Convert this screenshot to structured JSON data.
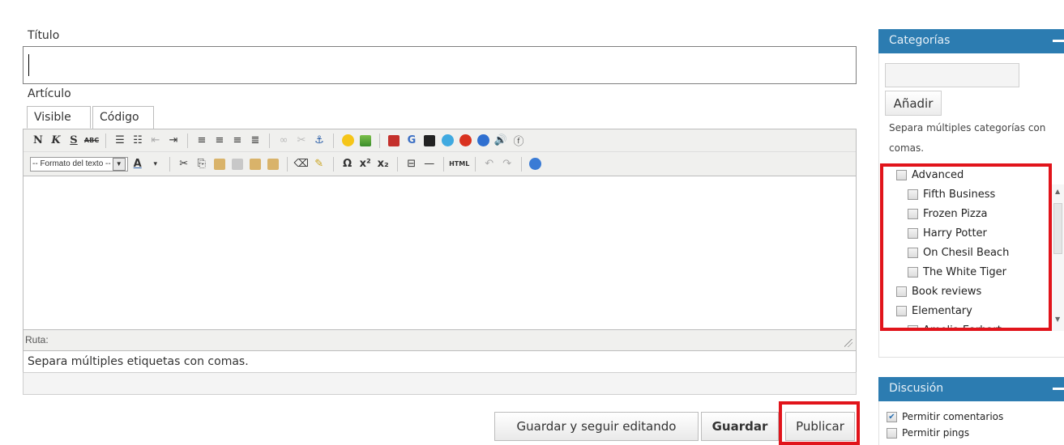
{
  "editor": {
    "title_label": "Título",
    "title_value": "",
    "article_label": "Artículo",
    "tabs": [
      {
        "label": "Visible",
        "active": true
      },
      {
        "label": "Código",
        "active": false
      }
    ],
    "toolbar_row1": {
      "bold": "N",
      "italic": "K",
      "underline": "S",
      "strike": "ABC",
      "icons": [
        "bold-icon",
        "italic-icon",
        "underline-icon",
        "strikethrough-icon",
        "bullet-list-icon",
        "numbered-list-icon",
        "outdent-icon",
        "indent-icon",
        "align-left-icon",
        "align-center-icon",
        "align-right-icon",
        "justify-icon",
        "link-icon",
        "unlink-icon",
        "anchor-icon",
        "emoticon-icon",
        "image-icon",
        "youtube-icon",
        "google-icon",
        "info-icon",
        "quicktime-icon",
        "realmedia-icon",
        "windows-media-icon",
        "audio-icon",
        "flash-icon"
      ]
    },
    "toolbar_row2": {
      "format_placeholder": "-- Formato del texto --",
      "html_label": "HTML",
      "omega": "Ω",
      "icons": [
        "text-color-icon",
        "cut-icon",
        "copy-icon",
        "paste-icon",
        "paste-text-icon",
        "paste-word-icon",
        "paste-special-icon",
        "eraser-icon",
        "clean-icon",
        "special-char-icon",
        "superscript-icon",
        "subscript-icon",
        "page-break-icon",
        "horizontal-rule-icon",
        "html-icon",
        "undo-icon",
        "redo-icon",
        "help-icon"
      ]
    },
    "path_label": "Ruta:",
    "tags_hint": "Separa múltiples etiquetas con comas.",
    "tags_value": "",
    "buttons": {
      "save_continue": "Guardar y seguir editando",
      "save": "Guardar",
      "publish": "Publicar"
    }
  },
  "sidebar": {
    "categories": {
      "title": "Categorías",
      "new_category_value": "",
      "add_label": "Añadir",
      "hint": "Separa múltiples categorías con comas.",
      "items": [
        {
          "label": "Advanced",
          "level": 0,
          "checked": false
        },
        {
          "label": "Fifth Business",
          "level": 1,
          "checked": false
        },
        {
          "label": "Frozen Pizza",
          "level": 1,
          "checked": false
        },
        {
          "label": "Harry Potter",
          "level": 1,
          "checked": false
        },
        {
          "label": "On Chesil Beach",
          "level": 1,
          "checked": false
        },
        {
          "label": "The White Tiger",
          "level": 1,
          "checked": false
        },
        {
          "label": "Book reviews",
          "level": 0,
          "checked": false
        },
        {
          "label": "Elementary",
          "level": 0,
          "checked": false
        },
        {
          "label": "Amelia Earhart",
          "level": 1,
          "checked": false
        }
      ]
    },
    "discussion": {
      "title": "Discusión",
      "options": [
        {
          "label": "Permitir comentarios",
          "checked": true
        },
        {
          "label": "Permitir pings",
          "checked": false
        }
      ]
    }
  },
  "colors": {
    "panel_header": "#2c7cb1",
    "highlight": "#e1141b",
    "toolbar_bg": "#f0f0ee"
  }
}
